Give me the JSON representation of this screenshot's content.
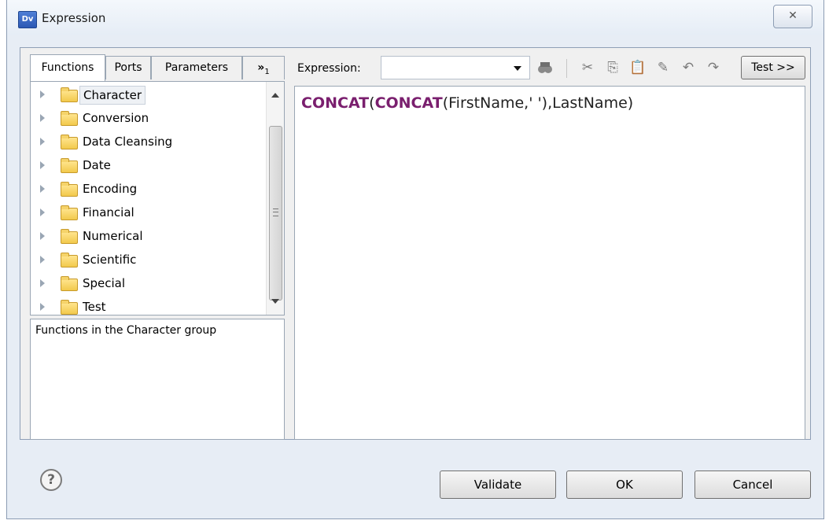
{
  "window": {
    "title": "Expression",
    "app_icon": "Dv",
    "close_glyph": "✕"
  },
  "tabs": [
    {
      "label": "Functions",
      "active": true
    },
    {
      "label": "Ports",
      "active": false
    },
    {
      "label": "Parameters",
      "active": false
    },
    {
      "label": "»",
      "sub": "1",
      "active": false
    }
  ],
  "tree": {
    "items": [
      {
        "label": "Character",
        "selected": true
      },
      {
        "label": "Conversion"
      },
      {
        "label": "Data Cleansing"
      },
      {
        "label": "Date"
      },
      {
        "label": "Encoding"
      },
      {
        "label": "Financial"
      },
      {
        "label": "Numerical"
      },
      {
        "label": "Scientific"
      },
      {
        "label": "Special"
      },
      {
        "label": "Test"
      }
    ],
    "description": "Functions in the Character group"
  },
  "toolbar": {
    "expression_label": "Expression:",
    "expression_value": "",
    "icons": [
      "binoculars-icon",
      "cut-icon",
      "copy-icon",
      "paste-icon",
      "edit-icon",
      "undo-icon",
      "redo-icon"
    ],
    "test_label": "Test >>"
  },
  "editor": {
    "parts": [
      {
        "text": "CONCAT",
        "kw": true
      },
      {
        "text": "(",
        "kw": false
      },
      {
        "text": "CONCAT",
        "kw": true
      },
      {
        "text": "(FirstName,' '),LastName)",
        "kw": false
      }
    ]
  },
  "footer": {
    "help_glyph": "?",
    "validate_label": "Validate",
    "ok_label": "OK",
    "cancel_label": "Cancel"
  }
}
